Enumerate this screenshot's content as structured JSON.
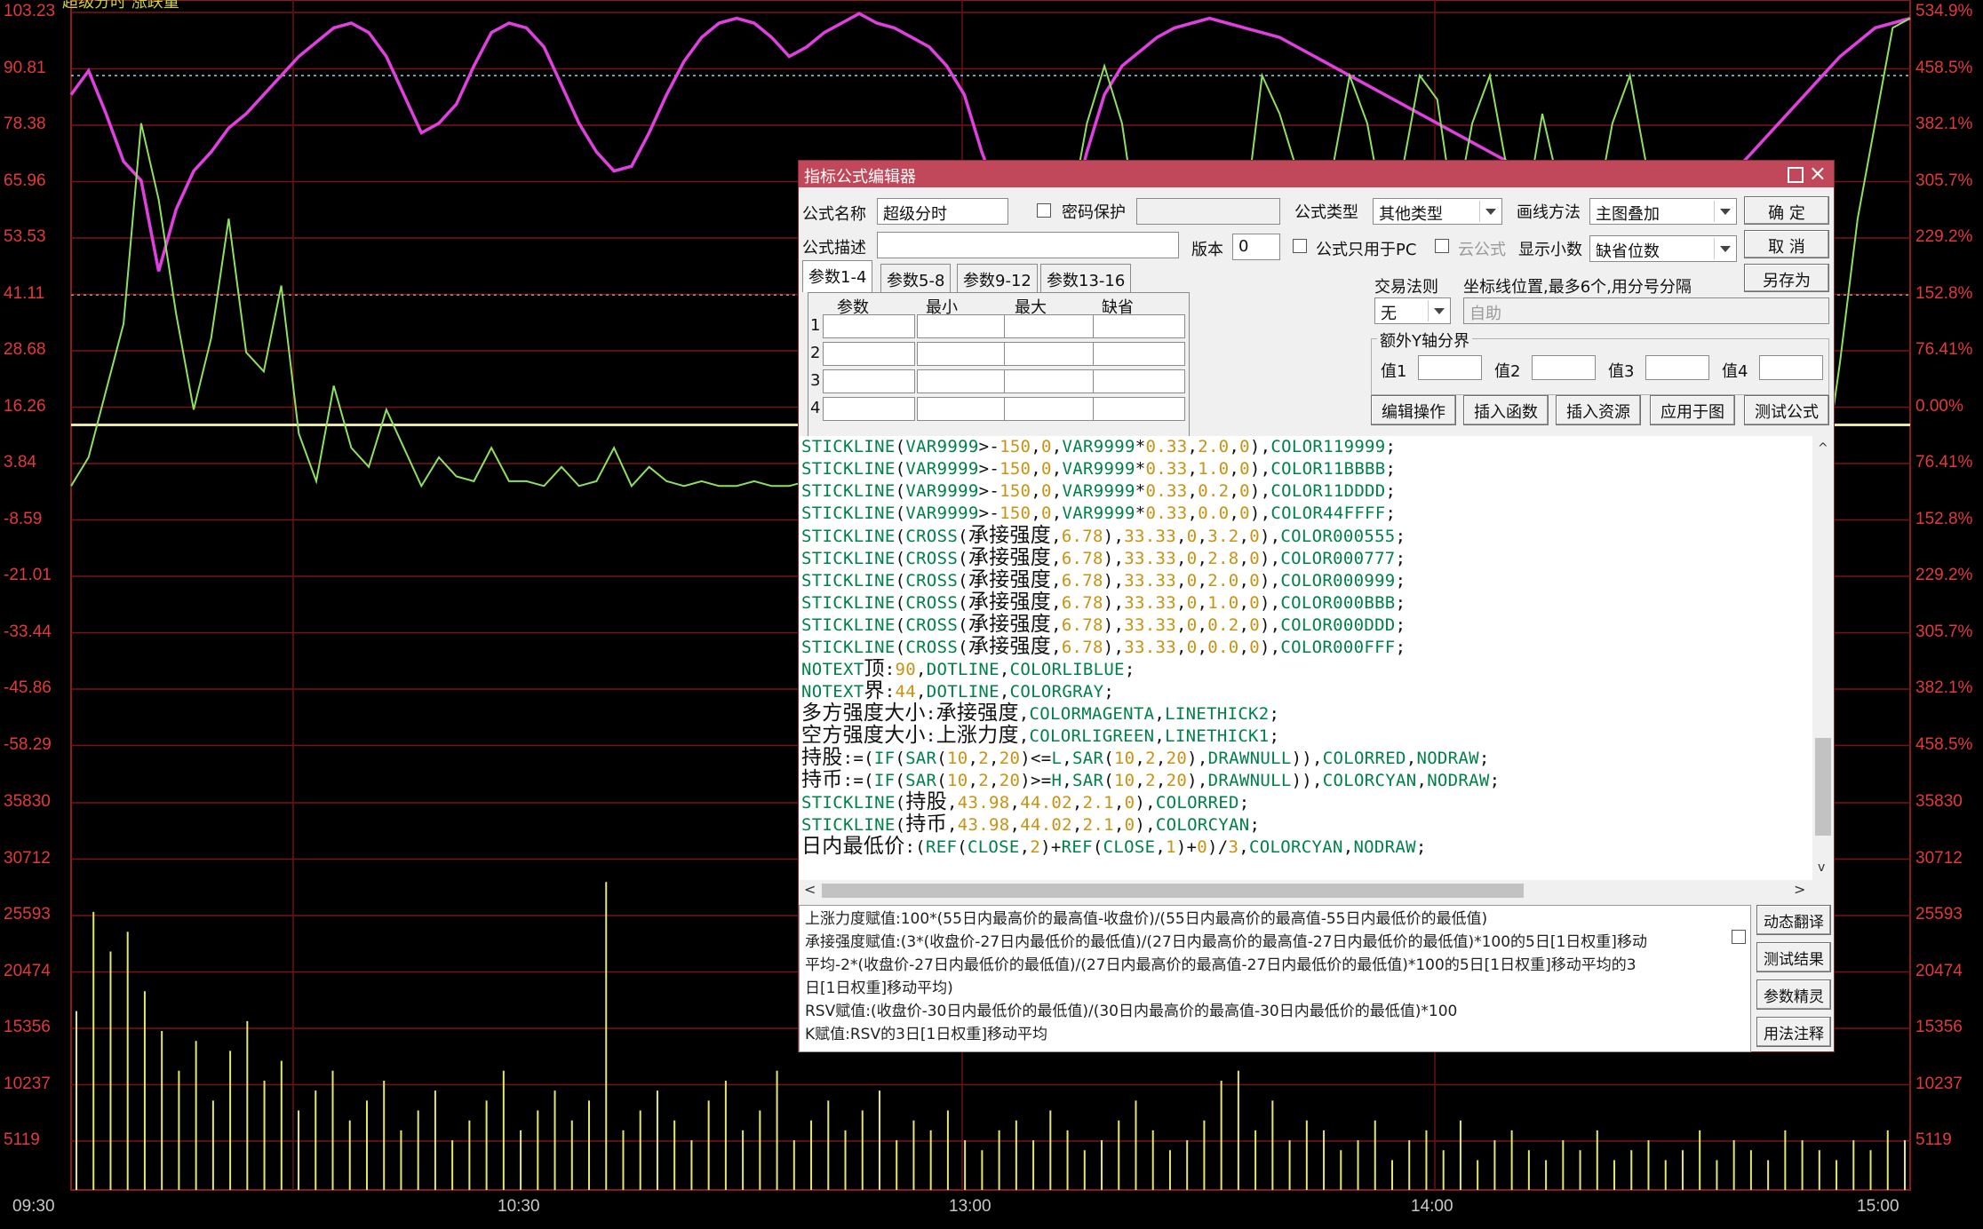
{
  "window": {
    "title": "超级分时 涨跌量"
  },
  "chart_data": [
    {
      "type": "line",
      "title": "",
      "x_ticks": [
        "09:30",
        "10:30",
        "13:00",
        "14:00",
        "15:00"
      ],
      "y_left_ticks": [
        "103.23",
        "90.81",
        "78.38",
        "65.96",
        "53.53",
        "41.11",
        "28.68",
        "16.26",
        "3.84",
        "-8.59",
        "-21.01",
        "-33.44",
        "-45.86",
        "-58.29"
      ],
      "y_right_ticks": [
        "534.9%",
        "458.5%",
        "382.1%",
        "305.7%",
        "229.2%",
        "152.8%",
        "76.41%",
        "0.00%",
        "76.41%",
        "152.8%",
        "229.2%",
        "305.7%",
        "382.1%",
        "458.5%"
      ],
      "ylim": [
        -58.29,
        103.23
      ],
      "reference_lines": {
        "顶": 90,
        "界": 44
      },
      "series": [
        {
          "name": "多方强度大小",
          "color": "#e040e0",
          "values": [
            86,
            91,
            82,
            72,
            68,
            49,
            62,
            70,
            74,
            79,
            82,
            86,
            90,
            94,
            97,
            100,
            101,
            99,
            94,
            86,
            78,
            80,
            84,
            92,
            99,
            101,
            100,
            96,
            88,
            80,
            74,
            70,
            71,
            78,
            86,
            93,
            98,
            101,
            102,
            101,
            98,
            94,
            96,
            99,
            101,
            103,
            101,
            100,
            98,
            96,
            92,
            86,
            74,
            64,
            56,
            50,
            51,
            60,
            74,
            86,
            92,
            95,
            98,
            100,
            101,
            102,
            101,
            100,
            99,
            98,
            96,
            94,
            92,
            90,
            88,
            86,
            84,
            82,
            80,
            78,
            76,
            74,
            72,
            70,
            68,
            66,
            64,
            62,
            60,
            58,
            56,
            56,
            58,
            62,
            66,
            70,
            74,
            78,
            82,
            86,
            90,
            94,
            97,
            100,
            101,
            102
          ]
        },
        {
          "name": "空方强度大小",
          "color": "#90e060",
          "values": [
            4,
            10,
            24,
            38,
            80,
            64,
            40,
            20,
            35,
            60,
            32,
            28,
            46,
            15,
            5,
            25,
            12,
            8,
            20,
            12,
            4,
            10,
            6,
            5,
            12,
            5,
            5,
            4,
            8,
            4,
            5,
            12,
            4,
            8,
            5,
            4,
            5,
            4,
            4,
            5,
            4,
            4,
            5,
            4,
            4,
            4,
            4,
            5,
            4,
            5,
            4,
            4,
            5,
            4,
            4,
            4,
            40,
            60,
            80,
            92,
            80,
            55,
            30,
            10,
            4,
            8,
            20,
            60,
            90,
            82,
            70,
            62,
            70,
            90,
            80,
            60,
            70,
            90,
            85,
            60,
            80,
            90,
            70,
            60,
            82,
            66,
            40,
            60,
            80,
            90,
            70,
            50,
            30,
            10,
            4,
            6,
            8,
            4,
            5,
            4,
            4,
            30,
            60,
            80,
            100,
            102
          ]
        }
      ]
    },
    {
      "type": "bar",
      "title": "",
      "y_left_ticks": [
        "35830",
        "30712",
        "25593",
        "20474",
        "15356",
        "10237",
        "5119"
      ],
      "y_right_ticks": [
        "35830",
        "30712",
        "25593",
        "20474",
        "15356",
        "10237",
        "5119"
      ],
      "ylim": [
        0,
        40948
      ],
      "series": [
        {
          "name": "",
          "color": "#e6e66a",
          "values": [
            18000,
            28000,
            24000,
            26000,
            20000,
            16000,
            12000,
            15000,
            9000,
            14000,
            17000,
            11000,
            13000,
            8000,
            10000,
            12000,
            7000,
            9000,
            11000,
            6000,
            8000,
            10000,
            5000,
            7000,
            9000,
            12000,
            6000,
            8000,
            10000,
            7000,
            9000,
            31000,
            6000,
            8000,
            10000,
            7000,
            5000,
            9000,
            11000,
            6000,
            8000,
            12000,
            5000,
            7000,
            9000,
            6000,
            8000,
            10000,
            5000,
            7000,
            6000,
            8000,
            5000,
            4000,
            6000,
            7000,
            5000,
            8000,
            6000,
            4000,
            5000,
            7000,
            9000,
            6000,
            4000,
            5000,
            7000,
            11000,
            12000,
            6000,
            9000,
            5000,
            7000,
            6000,
            4000,
            5000,
            7000,
            3000,
            5000,
            6000,
            4000,
            7000,
            3000,
            5000,
            6000,
            4000,
            3000,
            5000,
            4000,
            6000,
            3000,
            4000,
            5000,
            3000,
            4000,
            6000,
            3000,
            5000,
            4000,
            3000,
            6000,
            5000,
            4000,
            3000,
            5000,
            4000,
            6000,
            5000
          ]
        }
      ]
    }
  ],
  "dialog": {
    "title": "指标公式编辑器",
    "formula_name_label": "公式名称",
    "formula_name_value": "超级分时",
    "password_label": "密码保护",
    "formula_type_label": "公式类型",
    "formula_type_value": "其他类型",
    "draw_method_label": "画线方法",
    "draw_method_value": "主图叠加",
    "desc_label": "公式描述",
    "version_label": "版本",
    "version_value": "0",
    "pc_only_label": "公式只用于PC",
    "cloud_label": "云公式",
    "decimals_label": "显示小数",
    "decimals_value": "缺省位数",
    "btn_ok": "确 定",
    "btn_cancel": "取 消",
    "btn_saveas": "另存为",
    "tabs": [
      "参数1-4",
      "参数5-8",
      "参数9-12",
      "参数13-16"
    ],
    "param_headers": [
      "参数",
      "最小",
      "最大",
      "缺省"
    ],
    "param_rows": [
      "1",
      "2",
      "3",
      "4"
    ],
    "trade_rule_label": "交易法则",
    "trade_rule_value": "无",
    "coord_label": "坐标线位置,最多6个,用分号分隔",
    "coord_value": "自助",
    "yaxis_group_label": "额外Y轴分界",
    "yaxis_values": [
      "值1",
      "值2",
      "值3",
      "值4"
    ],
    "btn_edit": "编辑操作",
    "btn_insert_func": "插入函数",
    "btn_insert_res": "插入资源",
    "btn_apply": "应用于图",
    "btn_test": "测试公式",
    "code_lines": [
      "STICKLINE(VAR9999>-150,0,VAR9999*0.33,2.0,0),COLOR119999;",
      "STICKLINE(VAR9999>-150,0,VAR9999*0.33,1.0,0),COLOR11BBBB;",
      "STICKLINE(VAR9999>-150,0,VAR9999*0.33,0.2,0),COLOR11DDDD;",
      "STICKLINE(VAR9999>-150,0,VAR9999*0.33,0.0,0),COLOR44FFFF;",
      "STICKLINE(CROSS(承接强度,6.78),33.33,0,3.2,0),COLOR000555;",
      "STICKLINE(CROSS(承接强度,6.78),33.33,0,2.8,0),COLOR000777;",
      "STICKLINE(CROSS(承接强度,6.78),33.33,0,2.0,0),COLOR000999;",
      "STICKLINE(CROSS(承接强度,6.78),33.33,0,1.0,0),COLOR000BBB;",
      "STICKLINE(CROSS(承接强度,6.78),33.33,0,0.2,0),COLOR000DDD;",
      "STICKLINE(CROSS(承接强度,6.78),33.33,0,0.0,0),COLOR000FFF;",
      "NOTEXT顶:90,DOTLINE,COLORLIBLUE;",
      "NOTEXT界:44,DOTLINE,COLORGRAY;",
      "多方强度大小:承接强度,COLORMAGENTA,LINETHICK2;",
      "空方强度大小:上涨力度,COLORLIGREEN,LINETHICK1;",
      "持股:=(IF(SAR(10,2,20)<=L,SAR(10,2,20),DRAWNULL)),COLORRED,NODRAW;",
      "持币:=(IF(SAR(10,2,20)>=H,SAR(10,2,20),DRAWNULL)),COLORCYAN,NODRAW;",
      "STICKLINE(持股,43.98,44.02,2.1,0),COLORRED;",
      "STICKLINE(持币,43.98,44.02,2.1,0),COLORCYAN;",
      "日内最低价:(REF(CLOSE,2)+REF(CLOSE,1)+0)/3,COLORCYAN,NODRAW;"
    ],
    "description_lines": [
      "上涨力度赋值:100*(55日内最高价的最高值-收盘价)/(55日内最高价的最高值-55日内最低价的最低值)",
      "承接强度赋值:(3*(收盘价-27日内最低价的最低值)/(27日内最高价的最高值-27日内最低价的最低值)*100的5日[1日权重]移动",
      "平均-2*(收盘价-27日内最低价的最低值)/(27日内最高价的最高值-27日内最低价的最低值)*100的5日[1日权重]移动平均的3",
      "日[1日权重]移动平均)",
      "RSV赋值:(收盘价-30日内最低价的最低值)/(30日内最高价的最高值-30日内最低价的最低值)*100",
      "K赋值:RSV的3日[1日权重]移动平均"
    ],
    "btn_dyn_translate": "动态翻译",
    "btn_test_result": "测试结果",
    "btn_param_wizard": "参数精灵",
    "btn_usage": "用法注释"
  }
}
